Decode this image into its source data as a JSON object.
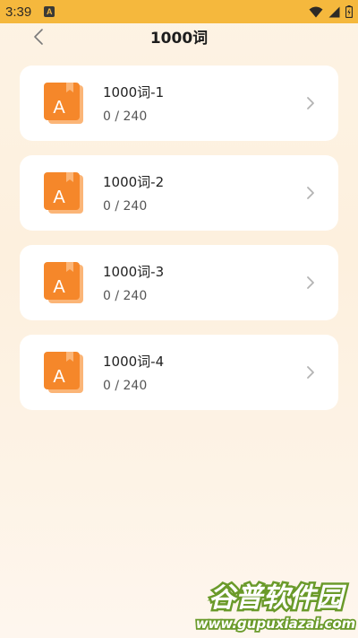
{
  "status": {
    "time": "3:39",
    "notif_letter": "A"
  },
  "header": {
    "title": "1000词"
  },
  "cards": [
    {
      "title": "1000词-1",
      "progress": "0 / 240"
    },
    {
      "title": "1000词-2",
      "progress": "0 / 240"
    },
    {
      "title": "1000词-3",
      "progress": "0 / 240"
    },
    {
      "title": "1000词-4",
      "progress": "0 / 240"
    }
  ],
  "icons": {
    "book": "book-a-icon",
    "chevron": "chevron-right-icon",
    "back": "back-arrow-icon"
  },
  "colors": {
    "status_bar": "#f5b83d",
    "icon_orange": "#f5872a",
    "icon_shadow": "#fbb577"
  },
  "watermark": {
    "title": "谷普软件园",
    "url": "www.gupuxiazai.com"
  }
}
